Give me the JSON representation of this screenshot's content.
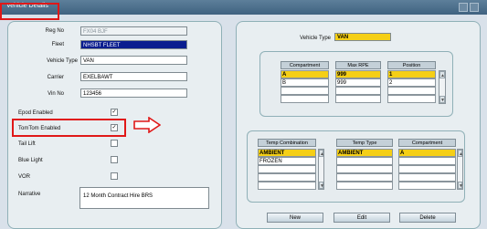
{
  "window": {
    "title": "Vehicle Details"
  },
  "left_form": {
    "reg_no": {
      "label": "Reg No",
      "value": "FX04 BJF"
    },
    "fleet": {
      "label": "Fleet",
      "value": "NHSBT FLEET"
    },
    "vehicle_type": {
      "label": "Vehicle Type",
      "value": "VAN"
    },
    "carrier": {
      "label": "Carrier",
      "value": "EXELBAWT"
    },
    "vin_no": {
      "label": "Vin No",
      "value": "123456"
    },
    "epod_enabled": {
      "label": "Epod Enabled",
      "checked": true
    },
    "tomtom_enabled": {
      "label": "TomTom Enabled",
      "checked": true
    },
    "tail_lift": {
      "label": "Tail Lift",
      "checked": false
    },
    "blue_light": {
      "label": "Blue Light",
      "checked": false
    },
    "vor": {
      "label": "VOR",
      "checked": false
    },
    "narrative": {
      "label": "Narrative",
      "value": "12 Month Contract Hire BRS"
    }
  },
  "right_panel": {
    "vehicle_type": {
      "label": "Vehicle Type",
      "value": "VAN"
    },
    "compartments": {
      "headers": [
        "Compartment",
        "Max RPE",
        "Position"
      ],
      "rows": [
        [
          "A",
          "999",
          "1"
        ],
        [
          "B",
          "999",
          "2"
        ]
      ]
    },
    "temps": {
      "headers": [
        "Temp Combination",
        "Temp Type",
        "Compartment"
      ],
      "rows": [
        [
          "AMBIENT",
          "AMBIENT",
          "A"
        ],
        [
          "FROZEN",
          "",
          ""
        ]
      ]
    }
  },
  "buttons": {
    "new": "New",
    "edit": "Edit",
    "delete": "Delete"
  },
  "check_mark": "✓",
  "annotation": {
    "arrow_color": "#e01818",
    "highlight_color": "#e01818"
  }
}
